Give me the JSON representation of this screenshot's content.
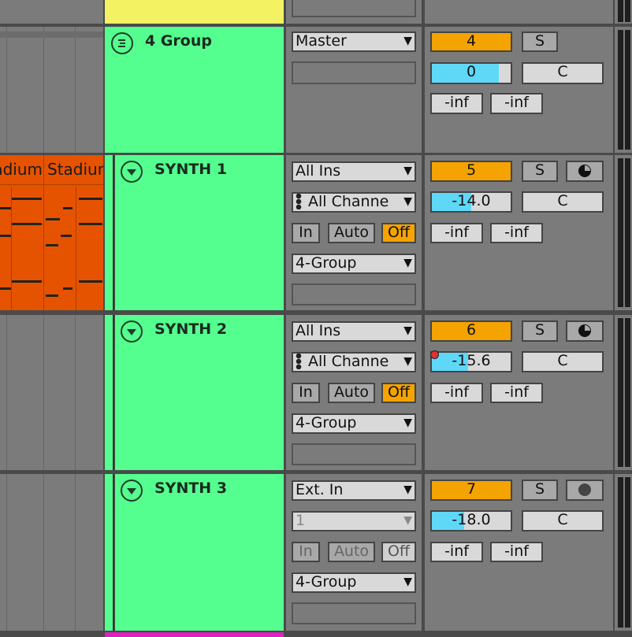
{
  "colors": {
    "group": "#55ff8f",
    "clip": "#e65300",
    "track_number": "#f5a300",
    "volume": "#5fd8f8",
    "prev_track": "#f2f262",
    "next_track": "#e020c0"
  },
  "clips": [
    {
      "label": "Stadium"
    },
    {
      "label": "Stadium"
    }
  ],
  "group": {
    "name": "4 Group",
    "icon": "group-fold-icon",
    "output": "Master",
    "number": "4",
    "solo": "S",
    "volume": "0",
    "volume_fraction": 0.85,
    "pan": "C",
    "peak_l": "-inf",
    "peak_r": "-inf"
  },
  "tracks": [
    {
      "name": "SYNTH 1",
      "icon": "fold-triangle-icon",
      "input": "All Ins",
      "channel": "All Channe",
      "monitor": [
        "In",
        "Auto",
        "Off"
      ],
      "monitor_active": "Off",
      "output": "4-Group",
      "number": "5",
      "solo": "S",
      "arm_icon": "clock-icon",
      "volume": "-14.0",
      "volume_fraction": 0.5,
      "pan": "C",
      "peak_l": "-inf",
      "peak_r": "-inf"
    },
    {
      "name": "SYNTH 2",
      "icon": "fold-triangle-icon",
      "input": "All Ins",
      "channel": "All Channe",
      "monitor": [
        "In",
        "Auto",
        "Off"
      ],
      "monitor_active": "Off",
      "output": "4-Group",
      "number": "6",
      "solo": "S",
      "arm_icon": "clock-icon",
      "volume": "-15.6",
      "volume_fraction": 0.46,
      "pan": "C",
      "peak_l": "-inf",
      "peak_r": "-inf"
    },
    {
      "name": "SYNTH 3",
      "icon": "fold-triangle-icon",
      "input": "Ext. In",
      "channel": "1",
      "monitor": [
        "In",
        "Auto",
        "Off"
      ],
      "monitor_active": "none",
      "output": "4-Group",
      "number": "7",
      "solo": "S",
      "arm_icon": "record-arm-icon",
      "volume": "-18.0",
      "volume_fraction": 0.41,
      "pan": "C",
      "peak_l": "-inf",
      "peak_r": "-inf"
    }
  ]
}
